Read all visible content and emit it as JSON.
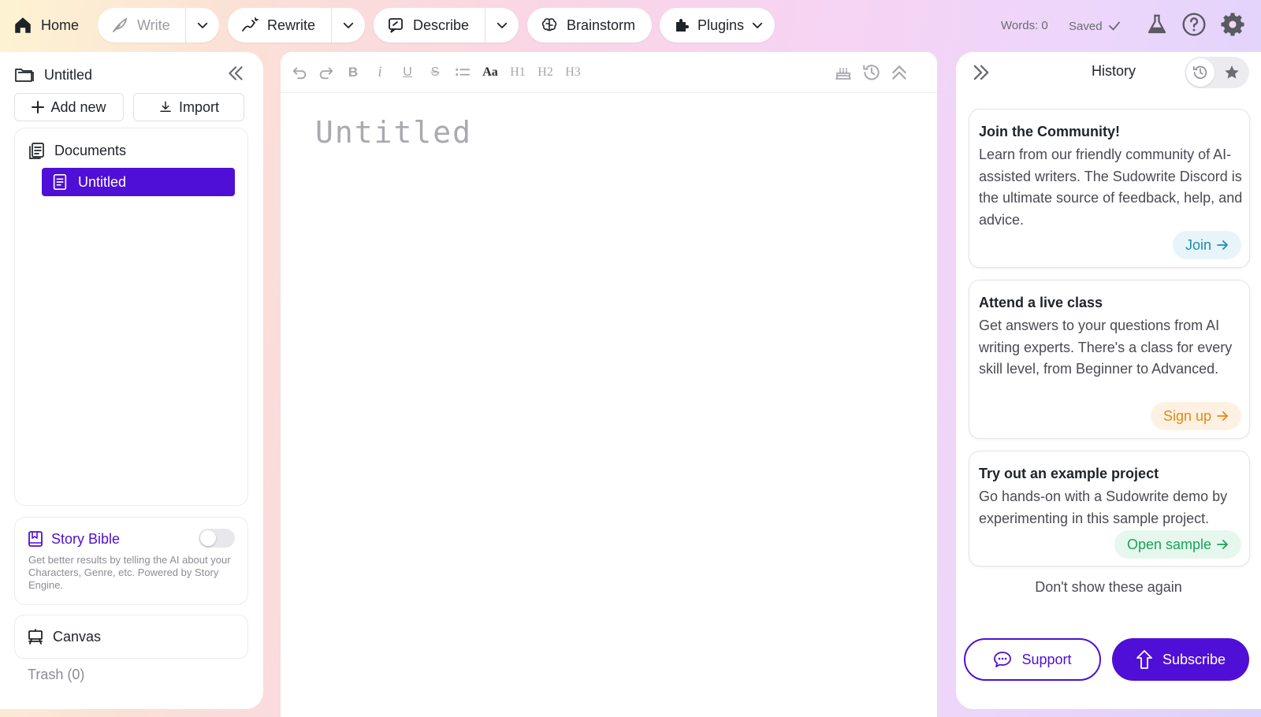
{
  "topbar": {
    "home_label": "Home",
    "write_label": "Write",
    "rewrite_label": "Rewrite",
    "describe_label": "Describe",
    "brainstorm_label": "Brainstorm",
    "plugins_label": "Plugins",
    "words_count": "Words: 0",
    "saved_label": "Saved",
    "icons": [
      "home-icon",
      "feather-icon",
      "rewrite-pen-icon",
      "describe-icon",
      "brain-icon",
      "puzzle-icon",
      "chevron-down-icon",
      "check-icon",
      "flask-icon",
      "help-icon",
      "gear-icon"
    ]
  },
  "sidebar": {
    "project_title": "Untitled",
    "add_new_label": "Add new",
    "import_label": "Import",
    "documents_label": "Documents",
    "documents": [
      {
        "title": "Untitled",
        "selected": true
      }
    ],
    "story_bible_label": "Story Bible",
    "story_bible_enabled": false,
    "story_bible_desc": "Get better results by telling the AI about your Characters, Genre, etc. Powered by Story Engine.",
    "canvas_label": "Canvas",
    "trash_label": "Trash (0)"
  },
  "editor": {
    "title_placeholder": "Untitled",
    "toolbar": {
      "aa": "Aa",
      "h1": "H1",
      "h2": "H2",
      "h3": "H3",
      "icons": [
        "undo-icon",
        "redo-icon",
        "bold-icon",
        "italic-icon",
        "underline-icon",
        "strikethrough-icon",
        "list-icon",
        "text-size-icon",
        "h1-icon",
        "h2-icon",
        "h3-icon",
        "cake-icon",
        "history-icon",
        "collapse-up-icon"
      ]
    }
  },
  "history_panel": {
    "title": "History",
    "cards": [
      {
        "title": "Join the Community!",
        "body": "Learn from our friendly community of AI-assisted writers. The Sudowrite Discord is the ultimate source of feedback, help, and advice.",
        "cta": "Join",
        "cta_color": "#1a8fb5",
        "cta_bg": "#e7f5fa"
      },
      {
        "title": "Attend a live class",
        "body": "Get answers to your questions from AI writing experts. There's a class for every skill level, from Beginner to Advanced.",
        "cta": "Sign up",
        "cta_color": "#e08a14",
        "cta_bg": "#fdf1e3"
      },
      {
        "title": "Try out an example project",
        "body": "Go hands-on with a Sudowrite demo by experimenting in this sample project.",
        "cta": "Open sample",
        "cta_color": "#19a35b",
        "cta_bg": "#e6f7ee"
      }
    ],
    "dont_show": "Don't show these again",
    "support_label": "Support",
    "subscribe_label": "Subscribe"
  },
  "colors": {
    "accent": "#4f0fd6",
    "muted_text": "#8c8c94"
  }
}
